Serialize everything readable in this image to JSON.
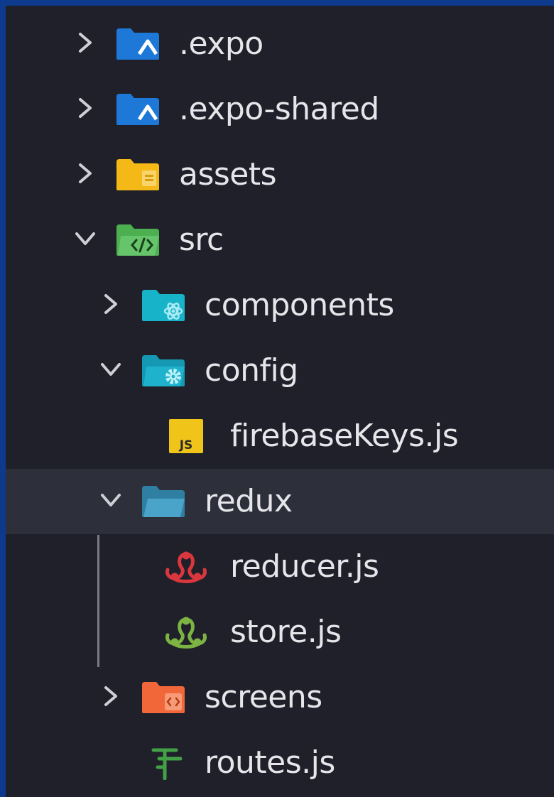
{
  "explorer": {
    "items": [
      {
        "label": ".expo",
        "expanded": false,
        "icon": "folder-expo-icon"
      },
      {
        "label": ".expo-shared",
        "expanded": false,
        "icon": "folder-expo-icon"
      },
      {
        "label": "assets",
        "expanded": false,
        "icon": "folder-assets-icon"
      },
      {
        "label": "src",
        "expanded": true,
        "icon": "folder-src-icon"
      },
      {
        "label": "components",
        "expanded": false,
        "icon": "folder-components-icon"
      },
      {
        "label": "config",
        "expanded": true,
        "icon": "folder-config-icon"
      },
      {
        "label": "firebaseKeys.js",
        "icon": "javascript-file-icon",
        "badge": "JS"
      },
      {
        "label": "redux",
        "expanded": true,
        "selected": true,
        "icon": "folder-redux-icon"
      },
      {
        "label": "reducer.js",
        "icon": "redux-reducer-icon"
      },
      {
        "label": "store.js",
        "icon": "redux-store-icon"
      },
      {
        "label": "screens",
        "expanded": false,
        "icon": "folder-screens-icon"
      },
      {
        "label": "routes.js",
        "icon": "routes-file-icon"
      }
    ]
  },
  "colors": {
    "background": "#1f2029",
    "selected_row": "#2d2f3a",
    "outer_frame": "#0d3a8c",
    "text": "#e6e6ea",
    "chevron": "#cfd0d6"
  }
}
